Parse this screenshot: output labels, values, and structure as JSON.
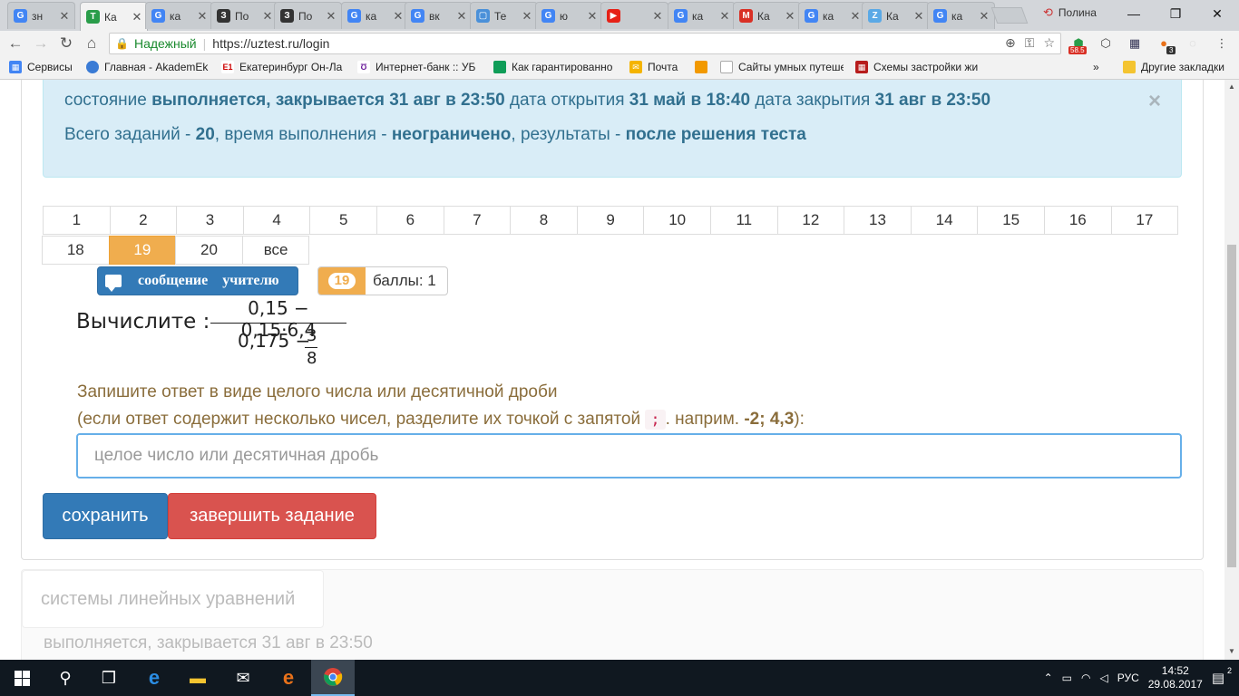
{
  "browser": {
    "tabs": [
      {
        "title": "зн",
        "icon": "G",
        "color": "#4285f4"
      },
      {
        "title": "Ка",
        "icon": "T",
        "color": "#2a9d4a",
        "active": true
      },
      {
        "title": "ка",
        "icon": "G",
        "color": "#4285f4"
      },
      {
        "title": "По",
        "icon": "З",
        "color": "#333333"
      },
      {
        "title": "По",
        "icon": "З",
        "color": "#333333"
      },
      {
        "title": "ка",
        "icon": "G",
        "color": "#4285f4"
      },
      {
        "title": "вк",
        "icon": "G",
        "color": "#4285f4"
      },
      {
        "title": "Те",
        "icon": "▢",
        "color": "#4a90d9"
      },
      {
        "title": "ю",
        "icon": "G",
        "color": "#4285f4"
      },
      {
        "title": "",
        "icon": "▶",
        "color": "#e62117"
      },
      {
        "title": "ка",
        "icon": "G",
        "color": "#4285f4"
      },
      {
        "title": "Ка",
        "icon": "M",
        "color": "#d93025"
      },
      {
        "title": "ка",
        "icon": "G",
        "color": "#4285f4"
      },
      {
        "title": "Ка",
        "icon": "Z",
        "color": "#5aa9e6"
      },
      {
        "title": "ка",
        "icon": "G",
        "color": "#4285f4"
      }
    ],
    "profile_name": "Полина",
    "secure_label": "Надежный",
    "url": "https://uztest.ru/login",
    "badge_value": "58.5",
    "badge_count": "3",
    "bookmarks": [
      {
        "label": "Сервисы",
        "color": "#4285f4"
      },
      {
        "label": "Главная - AkademEk",
        "color": "#3a7bd5"
      },
      {
        "label": "Екатеринбург Он-Ла",
        "color": "#cc0000"
      },
      {
        "label": "Интернет-банк :: УБ",
        "color": "#6a1b9a"
      },
      {
        "label": "Как гарантированно",
        "color": "#0f9d58"
      },
      {
        "label": "Почта",
        "color": "#f4b400"
      },
      {
        "label": "",
        "color": "#f29900"
      },
      {
        "label": "Сайты умных путеше",
        "color": "#888888"
      },
      {
        "label": "Схемы застройки жи",
        "color": "#b71c1c"
      }
    ],
    "other_bookmarks": "Другие закладки"
  },
  "test": {
    "status_label": "состояние",
    "status_value": "выполняется, закрывается 31 авг в 23:50",
    "open_label": "дата открытия",
    "open_value": "31 май в 18:40",
    "close_label": "дата закрытия",
    "close_value": "31 авг в 23:50",
    "total_label": "Всего заданий -",
    "total_value": "20",
    "time_label": ", время выполнения -",
    "time_value": "неограничено",
    "results_label": ", результаты -",
    "results_value": "после решения теста",
    "close_icon": "×"
  },
  "nav": {
    "row1": [
      "1",
      "2",
      "3",
      "4",
      "5",
      "6",
      "7",
      "8",
      "9",
      "10",
      "11",
      "12",
      "13",
      "14",
      "15",
      "16",
      "17"
    ],
    "row2": [
      "18",
      "19",
      "20",
      "все"
    ],
    "current": "19"
  },
  "message_button": {
    "word1": "сообщение",
    "word2": "учителю"
  },
  "score": {
    "number": "19",
    "points": "баллы: 1"
  },
  "task": {
    "label": "Вычислите :",
    "numerator": "0,15 − 0,15·6,4",
    "denominator": "0,175 −",
    "frac_num": "3",
    "frac_den": "8"
  },
  "hint": {
    "line1": "Запишите ответ в виде целого числа или десятичной дроби",
    "line2_pre": "(если ответ содержит несколько чисел, разделите их точкой с запятой",
    "separator": ";",
    "line2_mid": ". наприм.",
    "example": "-2; 4,3",
    "line2_end": "):"
  },
  "answer": {
    "placeholder": "целое число или десятичная дробь",
    "value": ""
  },
  "buttons": {
    "save": "сохранить",
    "finish": "завершить задание"
  },
  "next_test": {
    "title": "системы линейных уравнений",
    "status": "выполняется, закрывается 31 авг в 23:50"
  },
  "taskbar": {
    "lang": "РУС",
    "time": "14:52",
    "date": "29.08.2017",
    "notifications": "2"
  }
}
